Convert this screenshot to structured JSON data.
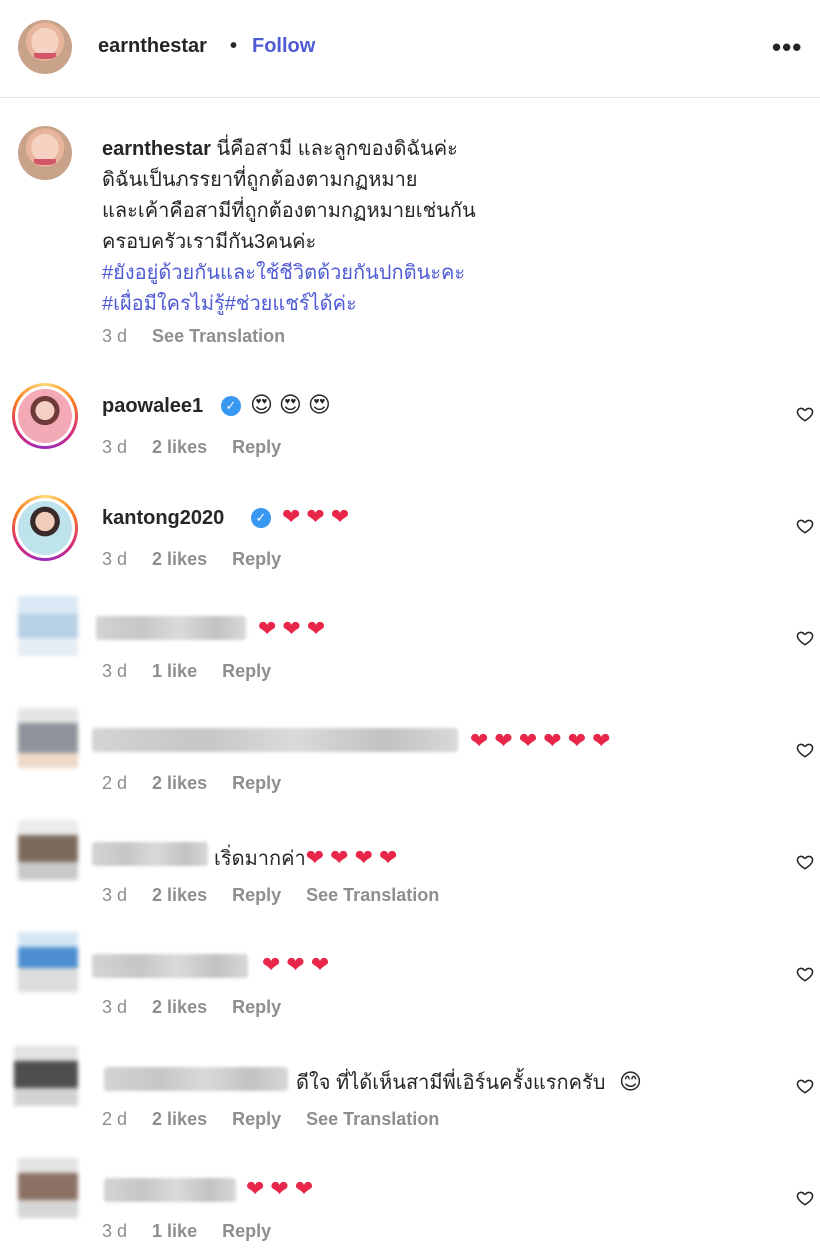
{
  "post": {
    "author": "earnthestar",
    "dot": "•",
    "follow_label": "Follow",
    "more_label": "•••"
  },
  "caption": {
    "username": "earnthestar",
    "lines": [
      "นี่คือสามี และลูกของดิฉันค่ะ",
      "ดิฉันเป็นภรรยาที่ถูกต้องตามกฏหมาย",
      "และเค้าคือสามีที่ถูกต้องตามกฏหมายเช่นกัน",
      "ครอบครัวเรามีกัน3คนค่ะ"
    ],
    "hashtags": [
      "#ยังอยู่ด้วยกันและใช้ชีวิตด้วยกันปกตินะคะ",
      "#เผื่อมีใครไม่รู้#ช่วยแชร์ได้ค่ะ"
    ],
    "time": "3 d",
    "see_translation": "See Translation"
  },
  "comments": [
    {
      "username": "paowalee1",
      "verified": true,
      "text": "😍😍😍",
      "time": "3 d",
      "likes": "2 likes",
      "reply": "Reply"
    },
    {
      "username": "kantong2020",
      "verified": true,
      "text": "❤❤❤",
      "time": "3 d",
      "likes": "2 likes",
      "reply": "Reply"
    },
    {
      "username": "",
      "text": "❤❤❤",
      "time": "3 d",
      "likes": "1 like",
      "reply": "Reply"
    },
    {
      "username": "",
      "text": "❤❤❤❤❤❤",
      "time": "2 d",
      "likes": "2 likes",
      "reply": "Reply"
    },
    {
      "username": "",
      "text": "เริ่ดมากค่า",
      "hearts": "❤❤❤❤",
      "time": "3 d",
      "likes": "2 likes",
      "reply": "Reply",
      "see_translation": "See Translation"
    },
    {
      "username": "",
      "text": "❤❤❤",
      "time": "3 d",
      "likes": "2 likes",
      "reply": "Reply"
    },
    {
      "username": "",
      "text": "ดีใจ ที่ได้เห็นสามีพี่เอิร์นครั้งแรกครับ",
      "emoji": "😊",
      "time": "2 d",
      "likes": "2 likes",
      "reply": "Reply",
      "see_translation": "See Translation"
    },
    {
      "username": "",
      "text": "❤❤❤",
      "time": "3 d",
      "likes": "1 like",
      "reply": "Reply"
    }
  ],
  "icons": {
    "verified": "verified-badge-icon",
    "like": "heart-outline-icon"
  },
  "colors": {
    "link": "#4f5bd5",
    "verified": "#3897f0",
    "heart": "#e8264a",
    "muted": "#8e8e8e"
  }
}
